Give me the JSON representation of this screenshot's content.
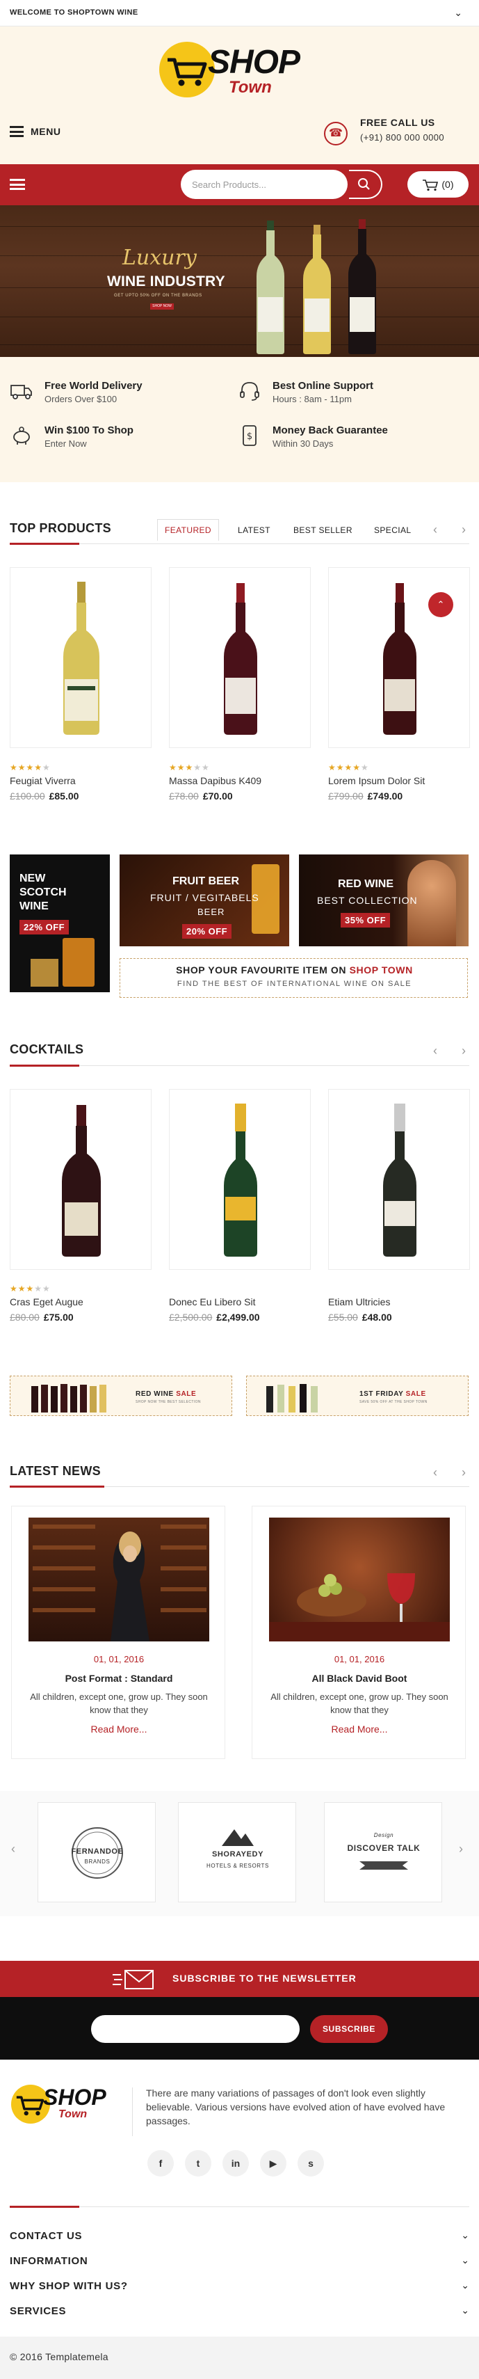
{
  "topbar": {
    "welcome": "WELCOME TO SHOPTOWN WINE"
  },
  "header": {
    "logo_main": "SHOP",
    "logo_sub": "Town",
    "menu_label": "MENU",
    "call_title": "FREE CALL US",
    "call_number": "(+91) 800 000 0000"
  },
  "search": {
    "placeholder": "Search Products..."
  },
  "cart": {
    "count": "(0)"
  },
  "hero": {
    "line1": "Luxury",
    "line2": "WINE INDUSTRY",
    "line3": "GET UPTO 50% OFF ON THE BRANDS",
    "button": "SHOP NOW"
  },
  "features": [
    {
      "icon": "truck-icon",
      "title": "Free World Delivery",
      "sub": "Orders Over $100"
    },
    {
      "icon": "headset-icon",
      "title": "Best Online Support",
      "sub": "Hours : 8am - 11pm"
    },
    {
      "icon": "piggy-bank-icon",
      "title": "Win $100 To Shop",
      "sub": "Enter Now"
    },
    {
      "icon": "money-back-icon",
      "title": "Money Back Guarantee",
      "sub": "Within 30 Days"
    }
  ],
  "top_products": {
    "title": "TOP PRODUCTS",
    "tabs": [
      "FEATURED",
      "LATEST",
      "BEST SELLER",
      "SPECIAL"
    ],
    "items": [
      {
        "name": "Feugiat Viverra",
        "old_price": "£100.00",
        "price": "£85.00",
        "rating": 4,
        "bottle_color": "#d7c35a"
      },
      {
        "name": "Massa Dapibus K409",
        "old_price": "£78.00",
        "price": "£70.00",
        "rating": 3,
        "bottle_color": "#5a1620"
      },
      {
        "name": "Lorem Ipsum Dolor Sit",
        "old_price": "£799.00",
        "price": "£749.00",
        "rating": 4,
        "bottle_color": "#4b1518"
      }
    ]
  },
  "promos": {
    "scotch": {
      "line1": "NEW",
      "line2": "SCOTCH",
      "line3": "WINE",
      "badge": "22% OFF"
    },
    "beer": {
      "line1": "FRUIT BEER",
      "line2": "FRUIT / VEGITABELS",
      "line3": "BEER",
      "badge": "20% OFF"
    },
    "red": {
      "line1": "RED WINE",
      "line2": "BEST COLLECTION",
      "badge": "35% OFF"
    },
    "shop_line1_a": "SHOP YOUR FAVOURITE ITEM ON",
    "shop_line1_b": "SHOP TOWN",
    "shop_line2": "FIND THE BEST OF INTERNATIONAL WINE ON SALE"
  },
  "cocktails": {
    "title": "COCKTAILS",
    "items": [
      {
        "name": "Cras Eget Augue",
        "old_price": "£80.00",
        "price": "£75.00",
        "rating": 3,
        "bottle_color": "#3a1416"
      },
      {
        "name": "Donec Eu Libero Sit",
        "old_price": "£2,500.00",
        "price": "£2,499.00",
        "rating": 0,
        "bottle_color": "#1f4a2a"
      },
      {
        "name": "Etiam Ultricies",
        "old_price": "£55.00",
        "price": "£48.00",
        "rating": 0,
        "bottle_color": "#2b2f27"
      }
    ]
  },
  "sales": [
    {
      "title_a": "RED WINE",
      "title_b": "SALE",
      "sub": "SHOP NOW THE BEST SELECTION"
    },
    {
      "title_a": "1ST FRIDAY",
      "title_b": "SALE",
      "sub": "SAVE 50% OFF AT THE SHOP TOWN"
    }
  ],
  "news": {
    "title": "LATEST NEWS",
    "items": [
      {
        "date": "01, 01, 2016",
        "title": "Post Format : Standard",
        "text": "All children, except one, grow up. They soon know that they",
        "more": "Read More..."
      },
      {
        "date": "01, 01, 2016",
        "title": "All Black David Boot",
        "text": "All children, except one, grow up. They soon know that they",
        "more": "Read More..."
      }
    ]
  },
  "brands": [
    {
      "name": "FERNANDOE",
      "sub": "BRANDS"
    },
    {
      "name": "SHORAYEDY",
      "sub": "HOTELS & RESORTS"
    },
    {
      "name": "DISCOVER TALK",
      "sub": "Design"
    }
  ],
  "newsletter": {
    "title": "SUBSCRIBE TO THE NEWSLETTER",
    "placeholder": "",
    "button": "SUBSCRIBE"
  },
  "footer": {
    "description": "There are many variations of passages of don't look even slightly believable. Various versions have evolved ation of have evolved have passages.",
    "social": [
      "f",
      "t",
      "in",
      "yt",
      "s"
    ],
    "sections": [
      "CONTACT US",
      "INFORMATION",
      "WHY SHOP WITH US?",
      "SERVICES"
    ],
    "copyright": "© 2016 Templatemela"
  },
  "colors": {
    "accent": "#b52226",
    "cream": "#fdf6e9",
    "logo_yellow": "#f5c518",
    "star": "#e6a623"
  }
}
